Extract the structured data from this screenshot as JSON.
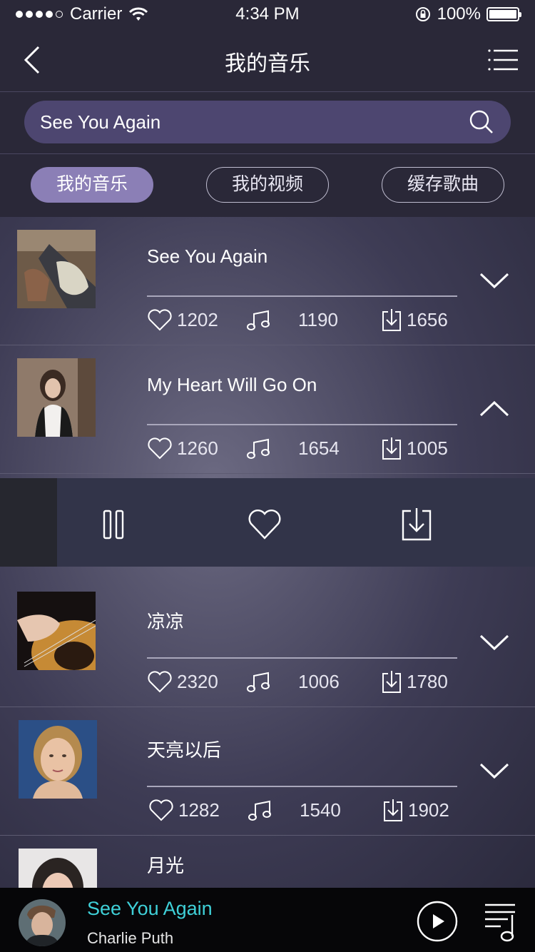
{
  "status_bar": {
    "carrier": "Carrier",
    "time": "4:34 PM",
    "battery": "100%"
  },
  "nav": {
    "title": "我的音乐"
  },
  "search": {
    "value": "See You Again"
  },
  "tabs": [
    {
      "label": "我的音乐",
      "active": true
    },
    {
      "label": "我的视频",
      "active": false
    },
    {
      "label": "缓存歌曲",
      "active": false
    }
  ],
  "songs": [
    {
      "title": "See You Again",
      "likes": "1202",
      "plays": "1190",
      "downloads": "1656",
      "expanded": false
    },
    {
      "title": "My Heart Will Go On",
      "likes": "1260",
      "plays": "1654",
      "downloads": "1005",
      "expanded": true
    },
    {
      "title": "凉凉",
      "likes": "2320",
      "plays": "1006",
      "downloads": "1780",
      "expanded": false
    },
    {
      "title": "天亮以后",
      "likes": "1282",
      "plays": "1540",
      "downloads": "1902",
      "expanded": false
    },
    {
      "title": "月光"
    }
  ],
  "player": {
    "title": "See You Again",
    "artist": "Charlie Puth"
  },
  "colors": {
    "accent_tab": "#8b7fb6",
    "now_playing_title": "#3fd0d8",
    "search_bg": "#4d4670"
  }
}
